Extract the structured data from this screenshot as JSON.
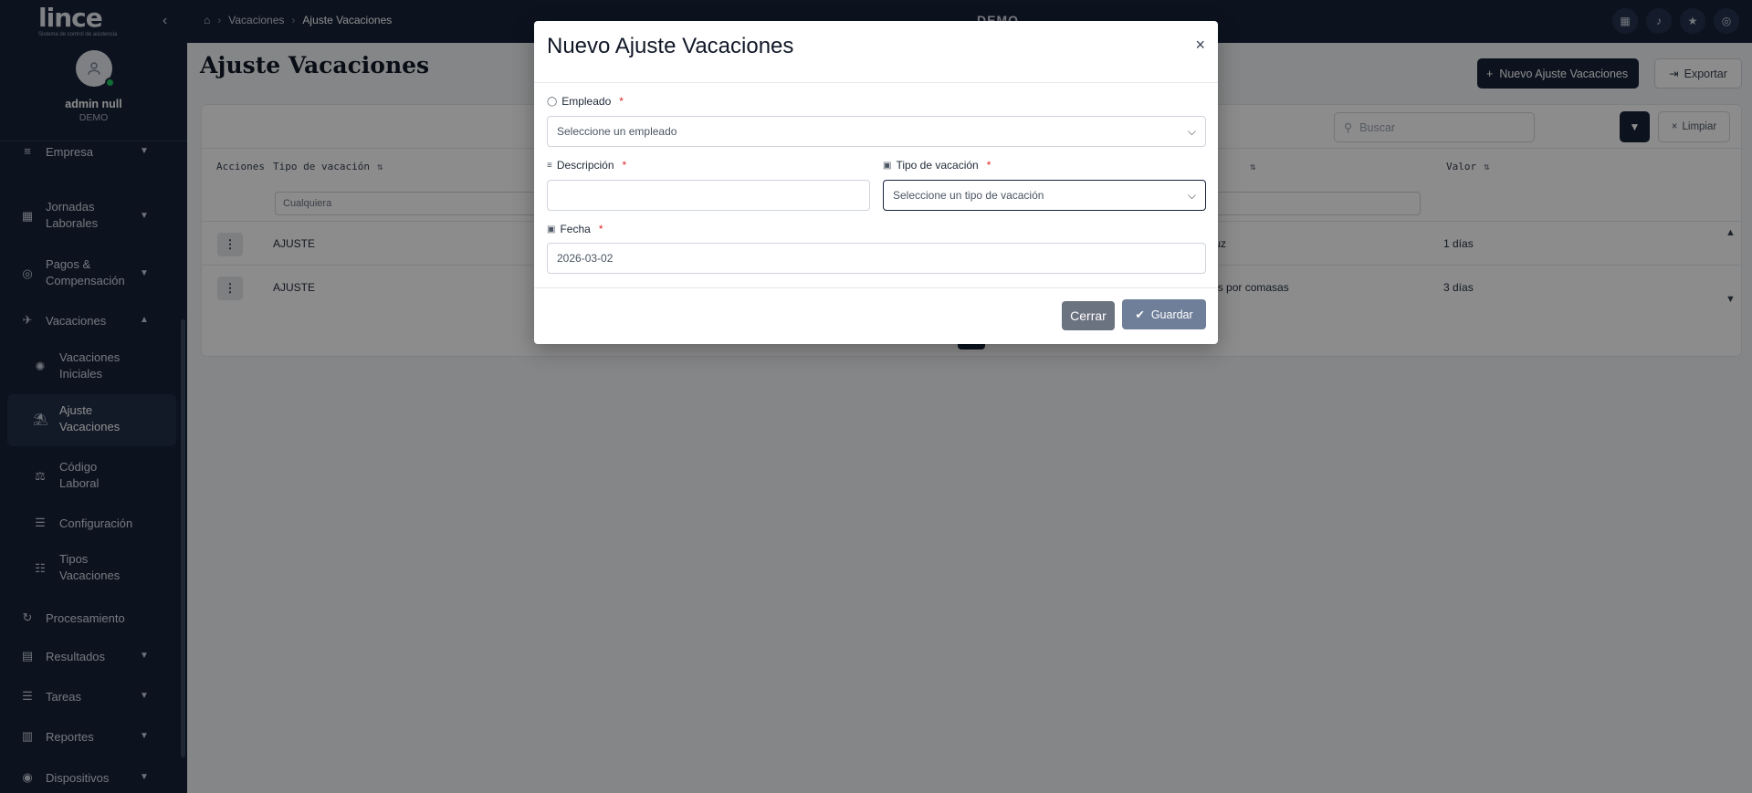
{
  "sidebar": {
    "logo": "lince",
    "logo_subtitle": "Sistema de control de asistencia",
    "user_name": "admin null",
    "user_company": "DEMO",
    "items": [
      {
        "label": "Empresa"
      },
      {
        "label": "Jornadas Laborales"
      },
      {
        "label": "Pagos & Compensación"
      },
      {
        "label": "Vacaciones"
      },
      {
        "label": "Vacaciones Iniciales"
      },
      {
        "label": "Ajuste Vacaciones"
      },
      {
        "label": "Código Laboral"
      },
      {
        "label": "Configuración"
      },
      {
        "label": "Tipos Vacaciones"
      },
      {
        "label": "Procesamiento"
      },
      {
        "label": "Resultados"
      },
      {
        "label": "Tareas"
      },
      {
        "label": "Reportes"
      },
      {
        "label": "Dispositivos"
      }
    ]
  },
  "topbar": {
    "breadcrumb": [
      "Vacaciones",
      "Ajuste Vacaciones"
    ],
    "center_title": "DEMO"
  },
  "main": {
    "title": "Ajuste Vacaciones",
    "new_button": "Nuevo Ajuste Vacaciones",
    "export_button": "Exportar",
    "search_placeholder": "Buscar",
    "clear_button": "Limpiar",
    "columns": [
      "Acciones",
      "Tipo de vacación",
      "Valor"
    ],
    "filter_value": "Cualquiera",
    "rows": [
      {
        "type": "AJUSTE",
        "description": "de luz",
        "value": "1 días"
      },
      {
        "type": "AJUSTE",
        "description": "iones por comasas",
        "value": "3 días"
      }
    ]
  },
  "modal": {
    "title": "Nuevo Ajuste Vacaciones",
    "close": "×",
    "employee_label": "Empleado",
    "employee_placeholder": "Seleccione un empleado",
    "description_label": "Descripción",
    "description_value": "",
    "vac_type_label": "Tipo de vacación",
    "vac_type_placeholder": "Seleccione un tipo de vacación",
    "date_label": "Fecha",
    "date_value": "2026-03-02",
    "required_mark": "*",
    "close_button": "Cerrar",
    "save_button": "Guardar"
  },
  "colors": {
    "navy": "#17233a",
    "overlay": "rgba(0,0,0,0.45)",
    "required": "#dc2626",
    "status_online": "#22c55e"
  }
}
